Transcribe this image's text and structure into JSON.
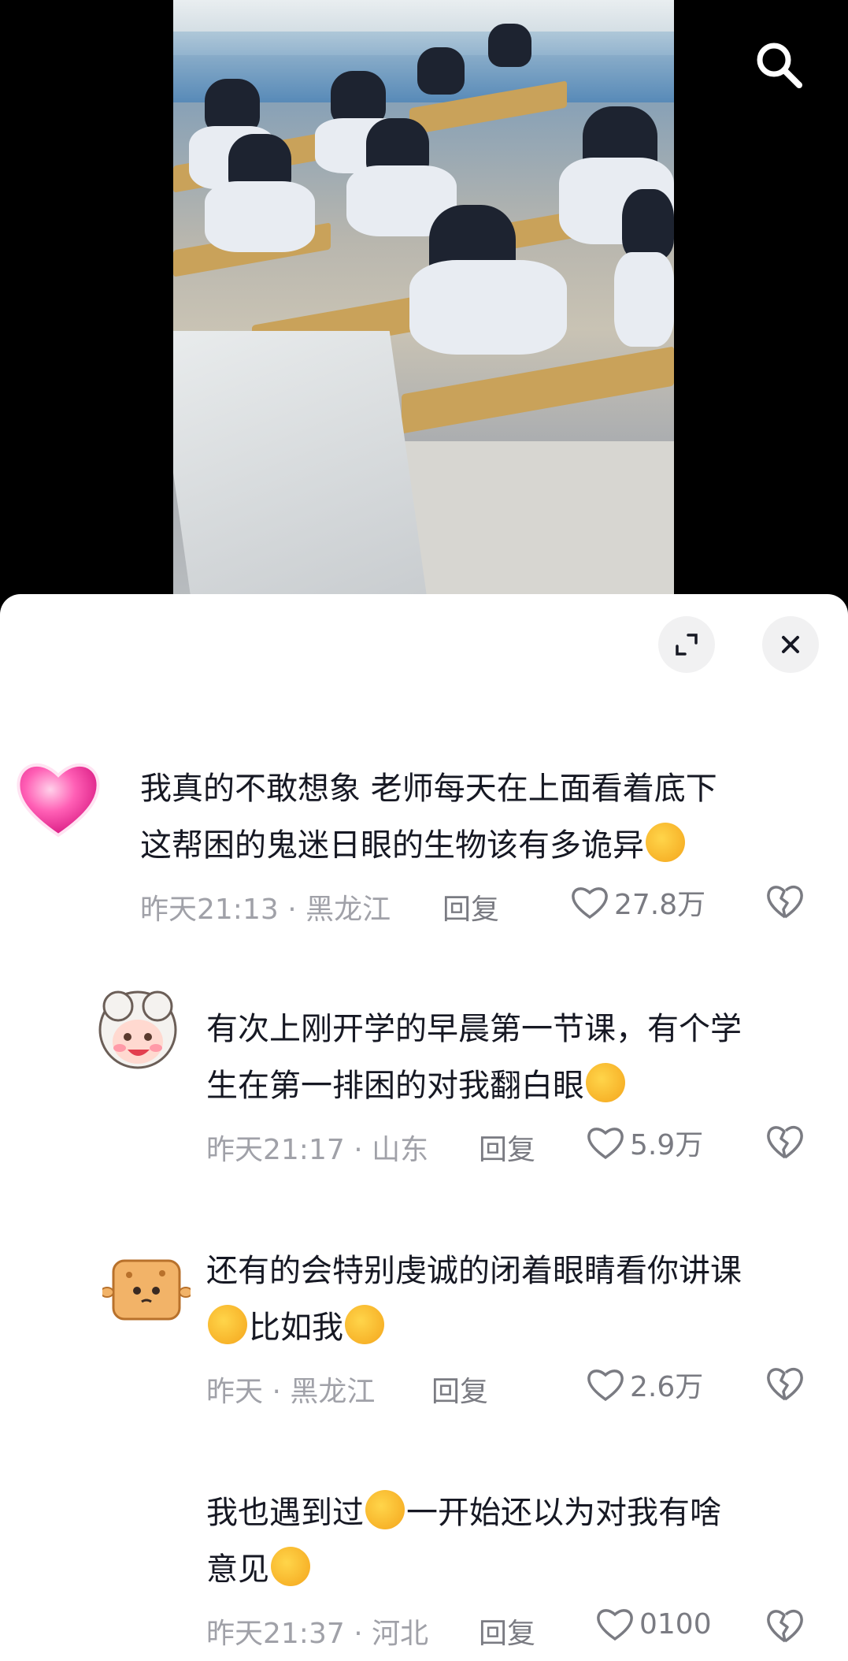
{
  "video": {
    "search_icon": "search-icon"
  },
  "panel": {
    "expand_icon": "expand-icon",
    "close_icon": "close-icon"
  },
  "comments": [
    {
      "line1": "我真的不敢想象 老师每天在上面看着底下",
      "line2": "这帮困的鬼迷日眼的生物该有多诡异",
      "time": "昨天21:13",
      "location": "黑龙江",
      "reply": "回复",
      "likes": "27.8万",
      "avatar_icon": "pink-heart-avatar"
    },
    {
      "line1": "有次上刚开学的早晨第一节课，有个学",
      "line2": "生在第一排困的对我翻白眼",
      "time": "昨天21:17",
      "location": "山东",
      "reply": "回复",
      "likes": "5.9万",
      "avatar_icon": "cartoon-sheep-avatar"
    },
    {
      "line1": "还有的会特别虔诚的闭着眼睛看你讲课",
      "line2a": "比如我",
      "time": "昨天",
      "location": "黑龙江",
      "reply": "回复",
      "likes": "2.6万",
      "avatar_icon": "cookie-avatar"
    },
    {
      "line1a": "我也遇到过",
      "line1b": "一开始还以为对我有啥",
      "line2a": "意见",
      "time": "昨天21:37",
      "location": "河北",
      "reply": "回复",
      "likes": "0100"
    }
  ],
  "separator": "·"
}
